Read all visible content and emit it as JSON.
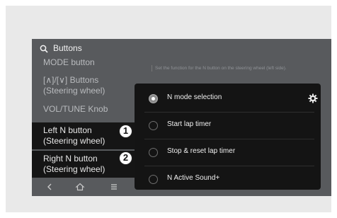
{
  "header": {
    "title": "Buttons"
  },
  "list": {
    "items": [
      {
        "label": "MODE button"
      },
      {
        "label_line1": "[∧]/[∨] Buttons",
        "label_line2": "(Steering wheel)"
      },
      {
        "label": "VOL/TUNE Knob"
      },
      {
        "label_line1": "Left N button",
        "label_line2": "(Steering wheel)",
        "selected": true
      },
      {
        "label_line1": "Right N button",
        "label_line2": "(Steering wheel)"
      }
    ]
  },
  "callouts": {
    "one": "1",
    "two": "2"
  },
  "description": "Set the function for the N button on the steering wheel (left side).",
  "popup": {
    "options": [
      {
        "label": "N mode selection",
        "selected": true
      },
      {
        "label": "Start lap timer",
        "selected": false
      },
      {
        "label": "Stop & reset lap timer",
        "selected": false
      },
      {
        "label": "N Active Sound+",
        "selected": false
      }
    ]
  },
  "bottom_nav": [
    "back-icon",
    "home-icon",
    "menu-icon"
  ],
  "colors": {
    "screen_bg": "#585a5d",
    "popup_bg": "#141414",
    "selected_bg": "#151515"
  }
}
